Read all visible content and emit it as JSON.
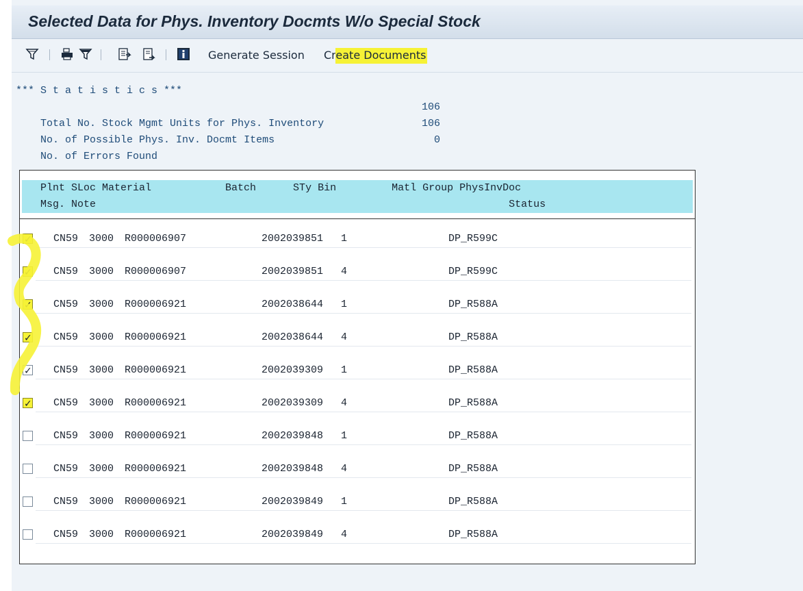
{
  "title": "Selected Data for Phys. Inventory Docmts W/o Special Stock",
  "toolbar": {
    "icons": [
      "filter-icon",
      "print-icon",
      "sum-icon",
      "export-icon",
      "export-local-icon",
      "info-icon"
    ],
    "generate_session": "Generate Session",
    "create_documents_prefix": "Cr",
    "create_documents_highlight": "eate Documents"
  },
  "statistics": {
    "heading": "*** S t a t i s t i c s ***",
    "lines": [
      {
        "label": "Total No. Stock Mgmt Units for Phys. Inventory",
        "value": "106"
      },
      {
        "label": "No. of Possible Phys. Inv. Docmt Items",
        "value": "106"
      },
      {
        "label": "No. of Errors Found",
        "value": "0"
      }
    ]
  },
  "table": {
    "header_line1": "Plnt SLoc Material            Batch      STy Bin         Matl Group PhysInvDoc",
    "header_line2": "Msg. Note                                                                   Status",
    "rows": [
      {
        "checked": true,
        "highlighted": true,
        "plant": "CN59",
        "sloc": "3000",
        "material": "R000006907",
        "batch": "2002039851",
        "sty": "1",
        "matl_group": "DP_R599C"
      },
      {
        "checked": true,
        "highlighted": true,
        "plant": "CN59",
        "sloc": "3000",
        "material": "R000006907",
        "batch": "2002039851",
        "sty": "4",
        "matl_group": "DP_R599C"
      },
      {
        "checked": true,
        "highlighted": true,
        "plant": "CN59",
        "sloc": "3000",
        "material": "R000006921",
        "batch": "2002038644",
        "sty": "1",
        "matl_group": "DP_R588A"
      },
      {
        "checked": true,
        "highlighted": true,
        "plant": "CN59",
        "sloc": "3000",
        "material": "R000006921",
        "batch": "2002038644",
        "sty": "4",
        "matl_group": "DP_R588A"
      },
      {
        "checked": true,
        "highlighted": false,
        "plant": "CN59",
        "sloc": "3000",
        "material": "R000006921",
        "batch": "2002039309",
        "sty": "1",
        "matl_group": "DP_R588A"
      },
      {
        "checked": true,
        "highlighted": true,
        "plant": "CN59",
        "sloc": "3000",
        "material": "R000006921",
        "batch": "2002039309",
        "sty": "4",
        "matl_group": "DP_R588A"
      },
      {
        "checked": false,
        "highlighted": false,
        "plant": "CN59",
        "sloc": "3000",
        "material": "R000006921",
        "batch": "2002039848",
        "sty": "1",
        "matl_group": "DP_R588A"
      },
      {
        "checked": false,
        "highlighted": false,
        "plant": "CN59",
        "sloc": "3000",
        "material": "R000006921",
        "batch": "2002039848",
        "sty": "4",
        "matl_group": "DP_R588A"
      },
      {
        "checked": false,
        "highlighted": false,
        "plant": "CN59",
        "sloc": "3000",
        "material": "R000006921",
        "batch": "2002039849",
        "sty": "1",
        "matl_group": "DP_R588A"
      },
      {
        "checked": false,
        "highlighted": false,
        "plant": "CN59",
        "sloc": "3000",
        "material": "R000006921",
        "batch": "2002039849",
        "sty": "4",
        "matl_group": "DP_R588A"
      }
    ]
  },
  "colors": {
    "highlight": "#f6f236",
    "header_bg": "#a8e6f0",
    "background": "#eef3f8"
  }
}
